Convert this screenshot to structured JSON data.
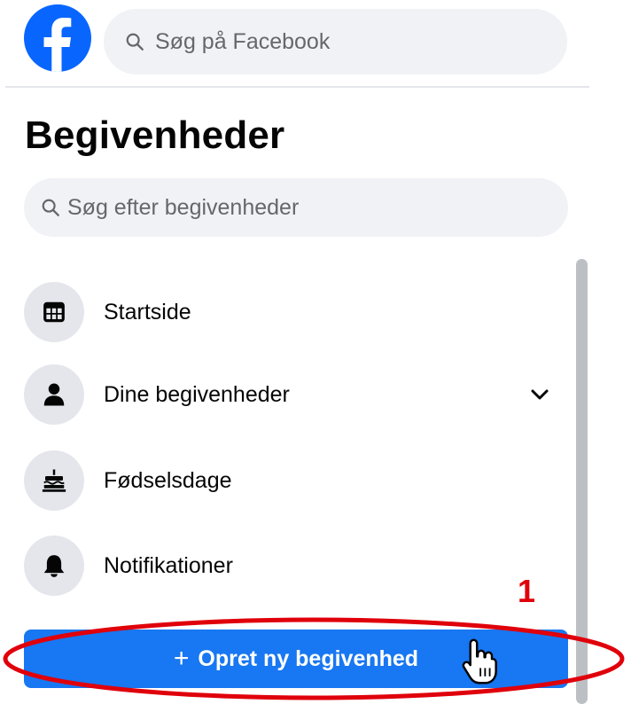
{
  "header": {
    "search_placeholder": "Søg på Facebook",
    "brand_color": "#0866ff"
  },
  "page": {
    "title": "Begivenheder",
    "search_placeholder": "Søg efter begivenheder"
  },
  "nav": {
    "items": [
      {
        "label": "Startside",
        "icon": "calendar-icon"
      },
      {
        "label": "Dine begivenheder",
        "icon": "person-icon",
        "expandable": true
      },
      {
        "label": "Fødselsdage",
        "icon": "cake-icon"
      },
      {
        "label": "Notifikationer",
        "icon": "bell-icon"
      }
    ]
  },
  "create_button": {
    "plus": "+",
    "label": "Opret ny begivenhed",
    "color": "#1877f2"
  },
  "annotation": {
    "number": "1",
    "color": "#e0000b"
  }
}
